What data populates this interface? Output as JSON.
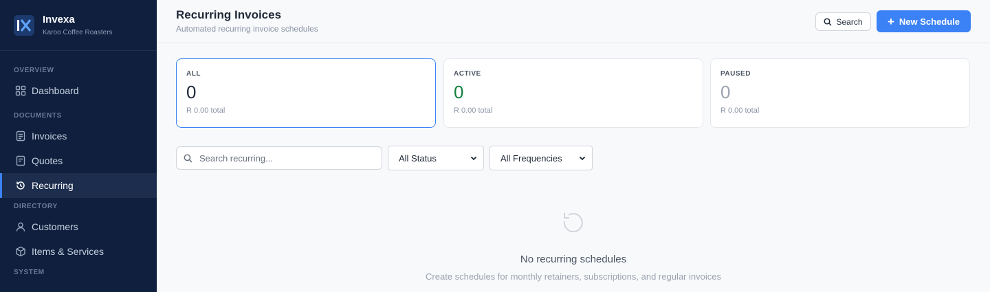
{
  "brand": {
    "name": "Invexa",
    "company": "Karoo Coffee Roasters"
  },
  "sidebar": {
    "sections": [
      {
        "title": "OVERVIEW",
        "items": [
          {
            "label": "Dashboard",
            "icon": "grid-icon"
          }
        ]
      },
      {
        "title": "DOCUMENTS",
        "items": [
          {
            "label": "Invoices",
            "icon": "document-icon"
          },
          {
            "label": "Quotes",
            "icon": "quote-icon"
          },
          {
            "label": "Recurring",
            "icon": "refresh-icon",
            "active": true
          }
        ]
      },
      {
        "title": "DIRECTORY",
        "items": [
          {
            "label": "Customers",
            "icon": "user-icon"
          },
          {
            "label": "Items & Services",
            "icon": "box-icon"
          }
        ]
      },
      {
        "title": "SYSTEM",
        "items": []
      }
    ]
  },
  "header": {
    "title": "Recurring Invoices",
    "subtitle": "Automated recurring invoice schedules",
    "search_label": "Search",
    "new_label": "New Schedule"
  },
  "stats": [
    {
      "label": "ALL",
      "value": "0",
      "total": "R 0.00 total",
      "color": "#1f2937"
    },
    {
      "label": "ACTIVE",
      "value": "0",
      "total": "R 0.00 total",
      "color": "#15803d"
    },
    {
      "label": "PAUSED",
      "value": "0",
      "total": "R 0.00 total",
      "color": "#9ca3af"
    }
  ],
  "filters": {
    "search_placeholder": "Search recurring...",
    "status_value": "All Status",
    "frequency_value": "All Frequencies"
  },
  "empty_state": {
    "title": "No recurring schedules",
    "subtitle": "Create schedules for monthly retainers, subscriptions, and regular invoices"
  },
  "colors": {
    "sidebar_bg": "#0f1f3d",
    "accent": "#3b82f6",
    "active_green": "#15803d"
  }
}
